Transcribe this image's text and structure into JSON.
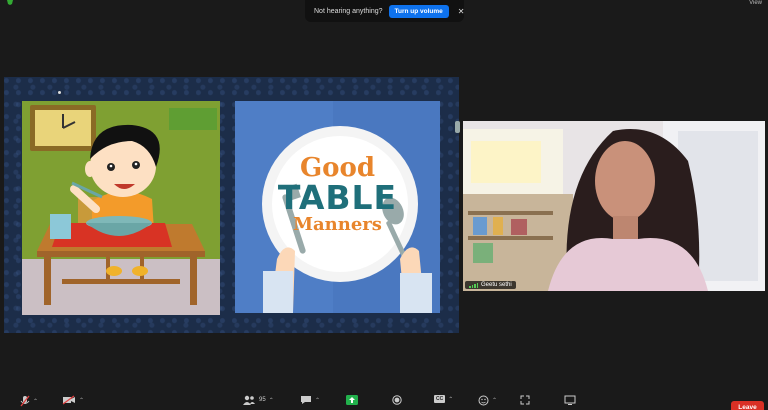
{
  "notification": {
    "message": "Not hearing anything?",
    "button_label": "Turn up volume",
    "close_icon": "close-icon"
  },
  "top_right": {
    "view_label": "View"
  },
  "shared_screen": {
    "right_panel": {
      "line1": "Good",
      "line2": "TABLE",
      "line3": "Manners"
    }
  },
  "participant": {
    "name": "Geetu sethi"
  },
  "toolbar": {
    "participants_count": "95",
    "items": [
      {
        "name": "mic-muted-icon"
      },
      {
        "name": "video-off-icon"
      },
      {
        "name": "participants-icon"
      },
      {
        "name": "chat-icon"
      },
      {
        "name": "share-screen-icon"
      },
      {
        "name": "record-icon"
      },
      {
        "name": "cc-icon"
      },
      {
        "name": "reactions-icon"
      },
      {
        "name": "apps-icon"
      },
      {
        "name": "whiteboard-icon"
      }
    ],
    "cc_label": "CC",
    "leave_label": "Leave"
  },
  "colors": {
    "share_bg": "#1c2d49",
    "accent_blue": "#0e72ed",
    "leave_red": "#d93025",
    "plate_letters_orange": "#e8852c",
    "plate_letters_teal": "#1f6f7a"
  }
}
